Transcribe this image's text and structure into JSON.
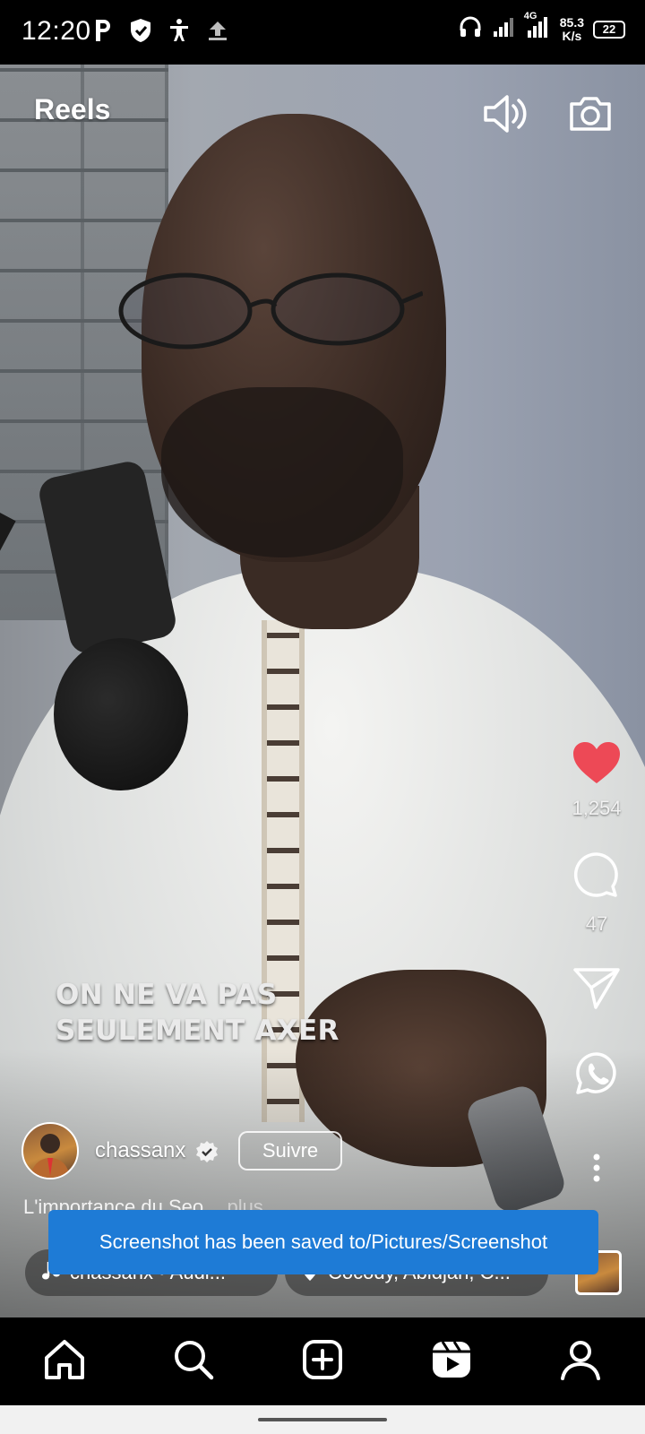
{
  "status_bar": {
    "time": "12:20",
    "network": "4G",
    "speed_value": "85.3",
    "speed_unit": "K/s",
    "battery": "22",
    "left_icons": [
      "parking-icon",
      "shield-icon",
      "accessibility-icon",
      "upload-icon"
    ],
    "right_icons": [
      "headphones-icon",
      "signal-icon",
      "signal-4g-icon"
    ]
  },
  "header": {
    "title": "Reels",
    "icons": [
      "speaker-icon",
      "camera-icon"
    ]
  },
  "video": {
    "caption_line1": "ON NE VA PAS",
    "caption_line2": "SEULEMENT AXER"
  },
  "actions": {
    "like_count": "1,254",
    "comment_count": "47",
    "liked": true,
    "like_color": "#ed4956"
  },
  "post": {
    "author": "chassanx",
    "follow_label": "Suivre",
    "description": "L'importance du Seo...",
    "more_label": "plus",
    "audio_label": "chassanx • Audi...",
    "location_label": "Cocody, Abidjan, C..."
  },
  "toast": {
    "message": "Screenshot has been saved to/Pictures/Screenshot",
    "color": "#1e7bd6"
  },
  "bottom_nav": {
    "items": [
      "home-icon",
      "search-icon",
      "create-icon",
      "reels-icon",
      "profile-icon"
    ],
    "active": "reels-icon"
  }
}
